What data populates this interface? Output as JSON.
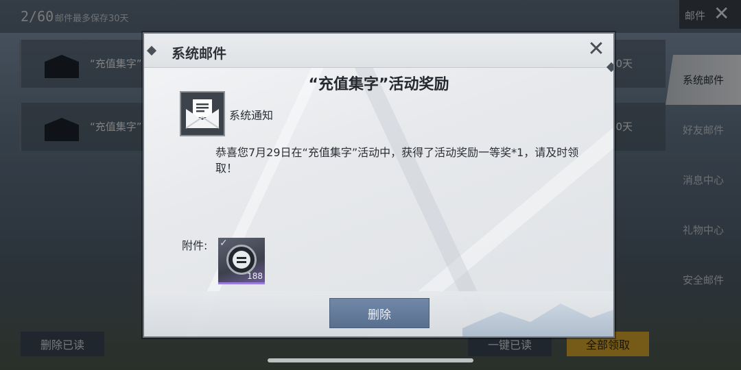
{
  "background": {
    "mail_count": "2/60",
    "mail_limit_note": "邮件最多保存30天",
    "top_right_label": "邮件",
    "mails": [
      {
        "subject": "“充值集字”",
        "days": "0天"
      },
      {
        "subject": "“充值集字”",
        "days": "0天"
      }
    ],
    "tabs": [
      "系统邮件",
      "好友邮件",
      "消息中心",
      "礼物中心",
      "安全邮件"
    ],
    "delete_read_label": "删除已读",
    "one_read_label": "一键已读",
    "claim_all_label": "全部领取"
  },
  "dialog": {
    "header_title": "系统邮件",
    "mail_title": "“充值集字”活动奖励",
    "sender": "系统通知",
    "body": "恭喜您7月29日在“充值集字”活动中，获得了活动奖励一等奖*1，请及时领取！",
    "attachment_label": "附件:",
    "attachment": {
      "quantity": "188",
      "icon": "coin-icon"
    },
    "delete_button": "删除"
  },
  "colors": {
    "claim_all": "#d4a62a",
    "delete_button": "#647b9b",
    "attachment_rarity": "#9a7be0"
  }
}
